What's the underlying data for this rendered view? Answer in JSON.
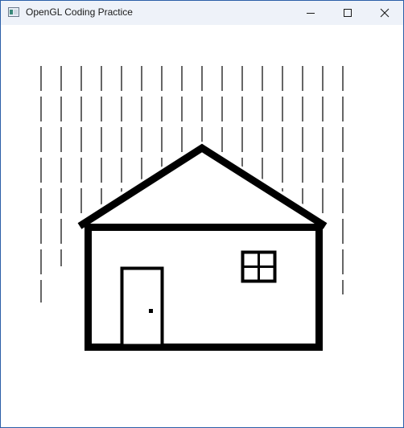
{
  "window": {
    "title": "OpenGL Coding Practice",
    "controls": {
      "minimize": "minimize-icon",
      "maximize": "maximize-icon",
      "close": "close-icon"
    }
  },
  "scene": {
    "description_elements": [
      "rain-streaks",
      "house",
      "roof",
      "door",
      "door-knob",
      "window"
    ],
    "stroke_color": "#000000",
    "background_color": "#ffffff"
  }
}
